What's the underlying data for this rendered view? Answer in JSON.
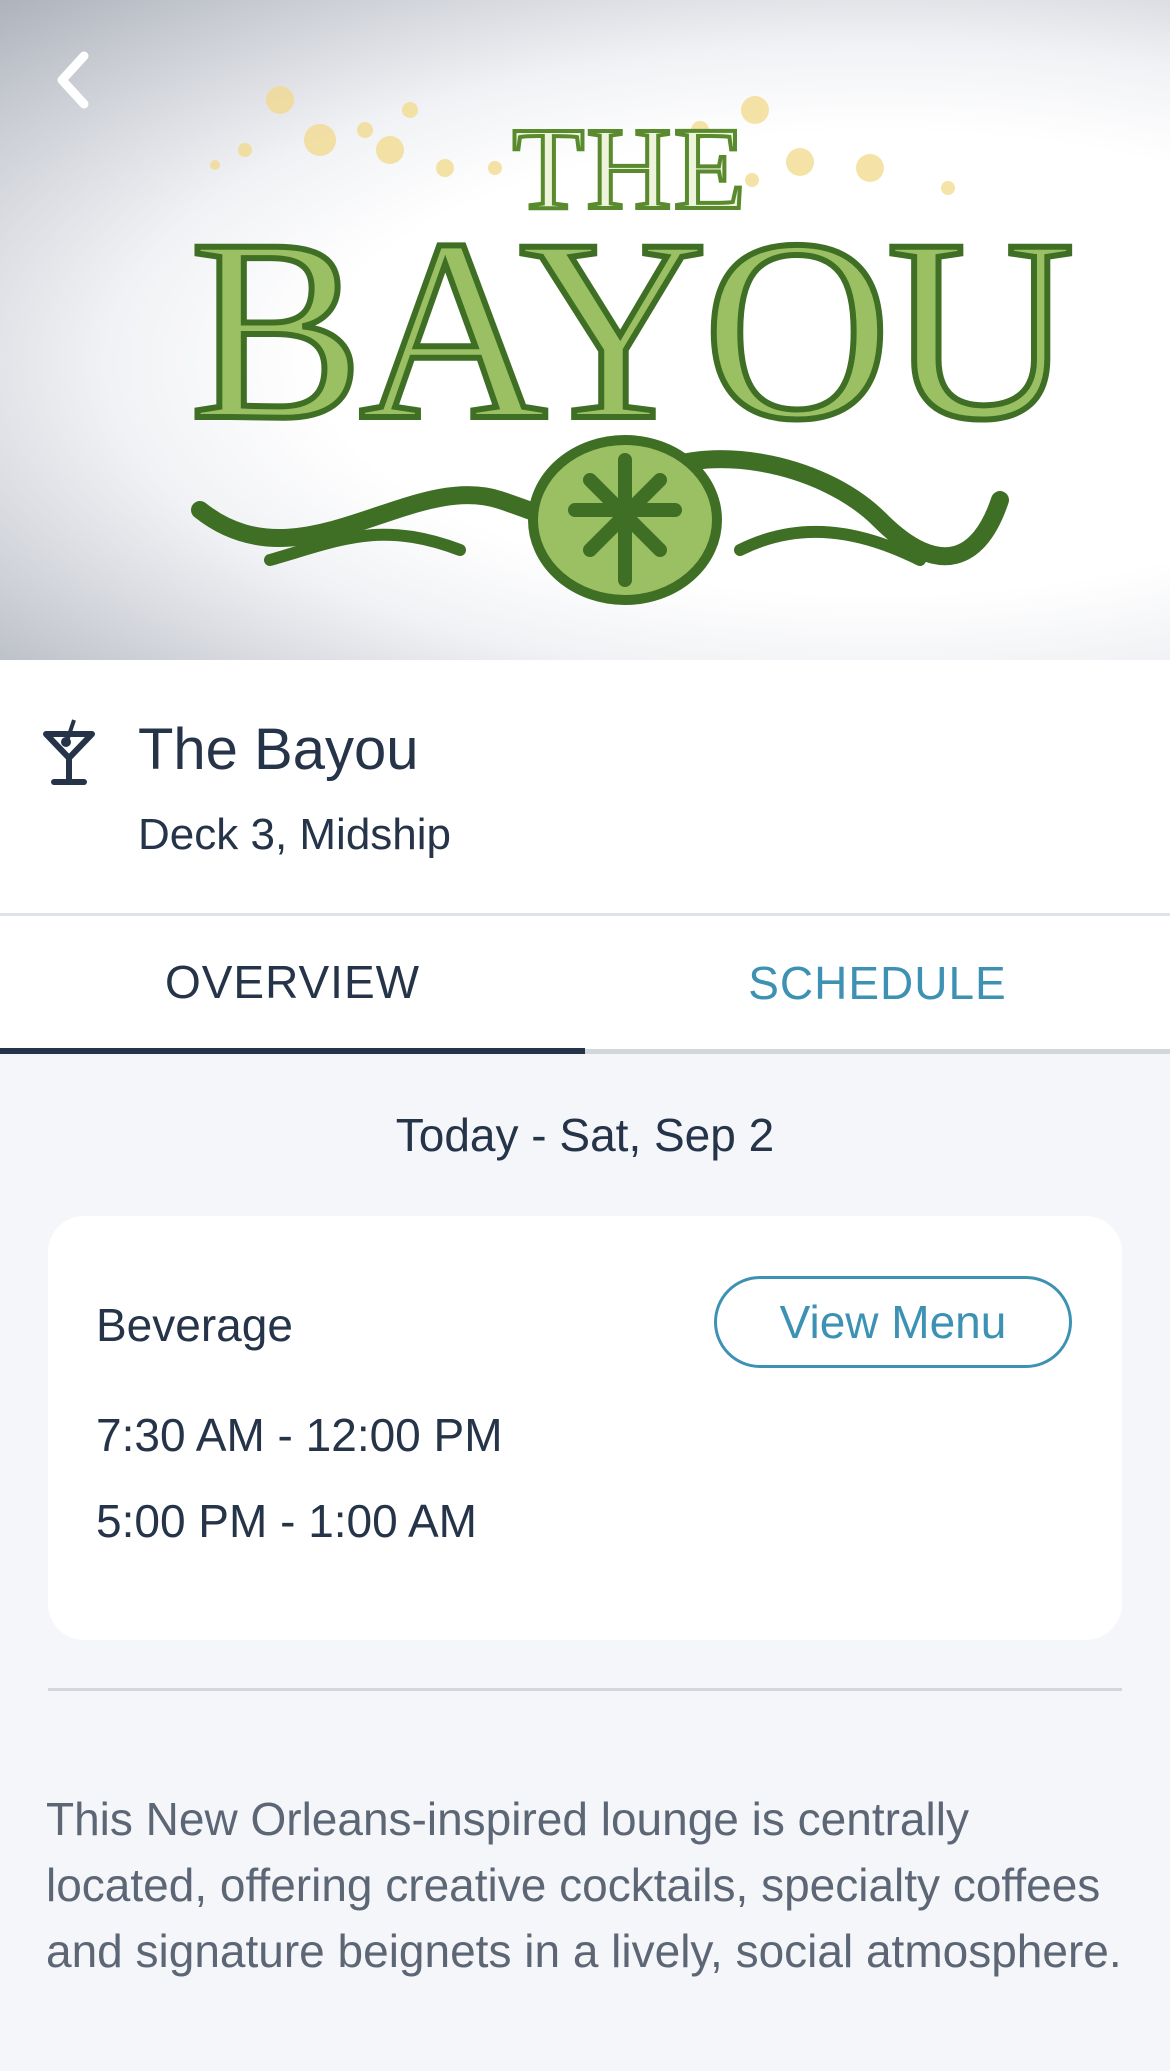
{
  "hero": {
    "logo_text_top": "THE",
    "logo_text_main": "BAYOU",
    "back_icon": "chevron-left-icon"
  },
  "venue": {
    "icon": "cocktail-icon",
    "title": "The Bayou",
    "location": "Deck 3, Midship"
  },
  "tabs": [
    {
      "label": "OVERVIEW",
      "active": true
    },
    {
      "label": "SCHEDULE",
      "active": false
    }
  ],
  "date_heading": "Today - Sat, Sep 2",
  "hours_card": {
    "category": "Beverage",
    "button_label": "View Menu",
    "hours": [
      "7:30 AM - 12:00 PM",
      "5:00 PM - 1:00 AM"
    ]
  },
  "description": "This New Orleans-inspired lounge is centrally located, offering creative cocktails, specialty coffees and signature beignets in a lively, social atmosphere.",
  "colors": {
    "primary_text": "#253449",
    "accent": "#3d91b3",
    "secondary_text": "#5c6675",
    "background": "#f4f6fa",
    "logo_green": "#9bbf63",
    "logo_dark_green": "#3f6f24"
  }
}
